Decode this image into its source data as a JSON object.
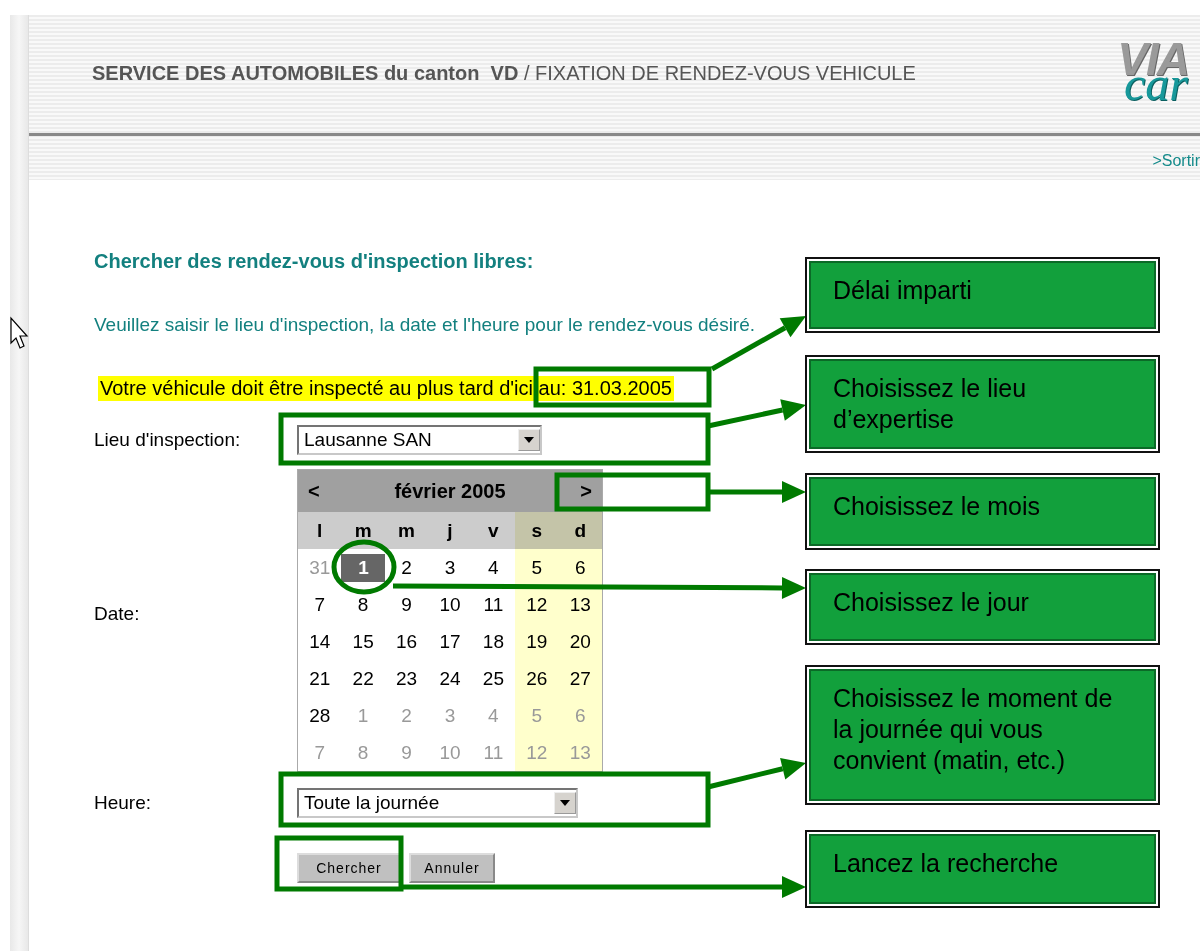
{
  "header": {
    "title": "**SERVICE DES AUTOMOBILES du canton  VD** / FIXATION DE RENDEZ-VOUS VEHICULE",
    "logo": {
      "top": "VIA",
      "bottom": "car"
    },
    "exit_link": ">Sortir"
  },
  "form": {
    "heading": "Chercher des rendez-vous d'inspection libres:",
    "instruction": "Veuillez saisir le lieu d'inspection, la date et l'heure pour le rendez-vous désiré.",
    "deadline": "Votre véhicule doit être inspecté au plus tard d'ici au: 31.03.2005",
    "location": {
      "label": "Lieu d'inspection:",
      "value": "Lausanne SAN"
    },
    "date": {
      "label": "Date:"
    },
    "time": {
      "label": "Heure:",
      "value": "Toute la journée"
    },
    "buttons": [
      {
        "label": "Chercher",
        "kind": "primary"
      },
      {
        "label": "Annuler",
        "kind": "secondary"
      }
    ]
  },
  "calendar": {
    "prev": "<",
    "month": "février 2005",
    "next": ">",
    "weekdays": [
      {
        "label": "l",
        "weekend": false
      },
      {
        "label": "m",
        "weekend": false
      },
      {
        "label": "m",
        "weekend": false
      },
      {
        "label": "j",
        "weekend": false
      },
      {
        "label": "v",
        "weekend": false
      },
      {
        "label": "s",
        "weekend": true
      },
      {
        "label": "d",
        "weekend": true
      }
    ],
    "weeks": [
      [
        {
          "day": "31",
          "other_month": true,
          "selected": false
        },
        {
          "day": "1",
          "other_month": false,
          "selected": true
        },
        {
          "day": "2",
          "other_month": false,
          "selected": false
        },
        {
          "day": "3",
          "other_month": false,
          "selected": false
        },
        {
          "day": "4",
          "other_month": false,
          "selected": false
        },
        {
          "day": "5",
          "other_month": false,
          "selected": false
        },
        {
          "day": "6",
          "other_month": false,
          "selected": false
        }
      ],
      [
        {
          "day": "7",
          "other_month": false,
          "selected": false
        },
        {
          "day": "8",
          "other_month": false,
          "selected": false
        },
        {
          "day": "9",
          "other_month": false,
          "selected": false
        },
        {
          "day": "10",
          "other_month": false,
          "selected": false
        },
        {
          "day": "11",
          "other_month": false,
          "selected": false
        },
        {
          "day": "12",
          "other_month": false,
          "selected": false
        },
        {
          "day": "13",
          "other_month": false,
          "selected": false
        }
      ],
      [
        {
          "day": "14",
          "other_month": false,
          "selected": false
        },
        {
          "day": "15",
          "other_month": false,
          "selected": false
        },
        {
          "day": "16",
          "other_month": false,
          "selected": false
        },
        {
          "day": "17",
          "other_month": false,
          "selected": false
        },
        {
          "day": "18",
          "other_month": false,
          "selected": false
        },
        {
          "day": "19",
          "other_month": false,
          "selected": false
        },
        {
          "day": "20",
          "other_month": false,
          "selected": false
        }
      ],
      [
        {
          "day": "21",
          "other_month": false,
          "selected": false
        },
        {
          "day": "22",
          "other_month": false,
          "selected": false
        },
        {
          "day": "23",
          "other_month": false,
          "selected": false
        },
        {
          "day": "24",
          "other_month": false,
          "selected": false
        },
        {
          "day": "25",
          "other_month": false,
          "selected": false
        },
        {
          "day": "26",
          "other_month": false,
          "selected": false
        },
        {
          "day": "27",
          "other_month": false,
          "selected": false
        }
      ],
      [
        {
          "day": "28",
          "other_month": false,
          "selected": false
        },
        {
          "day": "1",
          "other_month": true,
          "selected": false
        },
        {
          "day": "2",
          "other_month": true,
          "selected": false
        },
        {
          "day": "3",
          "other_month": true,
          "selected": false
        },
        {
          "day": "4",
          "other_month": true,
          "selected": false
        },
        {
          "day": "5",
          "other_month": true,
          "selected": false
        },
        {
          "day": "6",
          "other_month": true,
          "selected": false
        }
      ],
      [
        {
          "day": "7",
          "other_month": true,
          "selected": false
        },
        {
          "day": "8",
          "other_month": true,
          "selected": false
        },
        {
          "day": "9",
          "other_month": true,
          "selected": false
        },
        {
          "day": "10",
          "other_month": true,
          "selected": false
        },
        {
          "day": "11",
          "other_month": true,
          "selected": false
        },
        {
          "day": "12",
          "other_month": true,
          "selected": false
        },
        {
          "day": "13",
          "other_month": true,
          "selected": false
        }
      ]
    ]
  },
  "callouts": [
    {
      "text": "Délai imparti"
    },
    {
      "text": "Choisissez le lieu d’expertise"
    },
    {
      "text": "Choisissez le mois"
    },
    {
      "text": "Choisissez le jour"
    },
    {
      "text": "Choisissez le moment de la journée qui vous convient (matin, etc.)"
    },
    {
      "text": "Lancez la recherche"
    }
  ]
}
